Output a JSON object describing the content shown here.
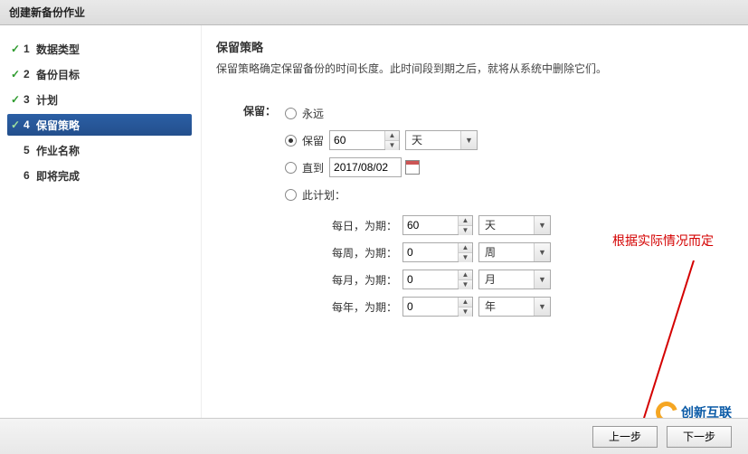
{
  "window": {
    "title": "创建新备份作业"
  },
  "steps": [
    {
      "num": "1",
      "label": "数据类型",
      "done": true,
      "active": false
    },
    {
      "num": "2",
      "label": "备份目标",
      "done": true,
      "active": false
    },
    {
      "num": "3",
      "label": "计划",
      "done": true,
      "active": false
    },
    {
      "num": "4",
      "label": "保留策略",
      "done": true,
      "active": true
    },
    {
      "num": "5",
      "label": "作业名称",
      "done": false,
      "active": false
    },
    {
      "num": "6",
      "label": "即将完成",
      "done": false,
      "active": false
    }
  ],
  "section": {
    "title": "保留策略",
    "desc": "保留策略确定保留备份的时间长度。此时间段到期之后，就将从系统中删除它们。"
  },
  "form": {
    "retain_label": "保留：",
    "opt_forever": "永远",
    "opt_keep": "保留",
    "opt_until": "直到",
    "opt_schedule": "此计划：",
    "keep_value": "60",
    "keep_unit": "天",
    "until_date": "2017/08/02",
    "sched": [
      {
        "label": "每日，为期：",
        "value": "60",
        "unit": "天"
      },
      {
        "label": "每周，为期：",
        "value": "0",
        "unit": "周"
      },
      {
        "label": "每月，为期：",
        "value": "0",
        "unit": "月"
      },
      {
        "label": "每年，为期：",
        "value": "0",
        "unit": "年"
      }
    ]
  },
  "annotation": "根据实际情况而定",
  "buttons": {
    "prev": "上一步",
    "next": "下一步"
  },
  "logo_text": "创新互联"
}
